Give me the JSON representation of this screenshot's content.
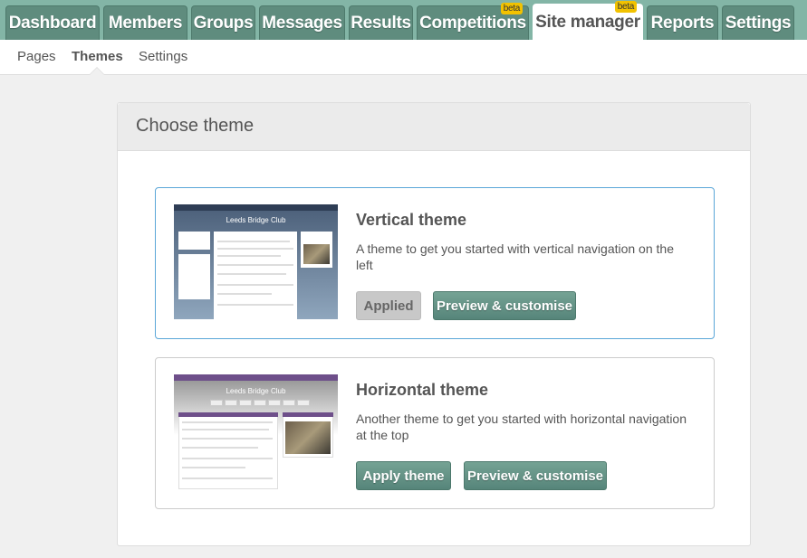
{
  "top_tabs": [
    {
      "label": "Dashboard",
      "badge": ""
    },
    {
      "label": "Members",
      "badge": ""
    },
    {
      "label": "Groups",
      "badge": ""
    },
    {
      "label": "Messages",
      "badge": ""
    },
    {
      "label": "Results",
      "badge": ""
    },
    {
      "label": "Competitions",
      "badge": "beta"
    },
    {
      "label": "Site manager",
      "badge": "beta",
      "active": true
    },
    {
      "label": "Reports",
      "badge": ""
    },
    {
      "label": "Settings",
      "badge": ""
    }
  ],
  "sub_nav": [
    {
      "label": "Pages"
    },
    {
      "label": "Themes",
      "active": true
    },
    {
      "label": "Settings"
    }
  ],
  "panel": {
    "title": "Choose theme"
  },
  "themes": [
    {
      "name": "Vertical theme",
      "description": "A theme to get you started with vertical navigation on the left",
      "primary_button": "Applied",
      "primary_disabled": true,
      "secondary_button": "Preview & customise",
      "preview_site_title": "Leeds Bridge Club"
    },
    {
      "name": "Horizontal theme",
      "description": "Another theme to get you started with horizontal navigation at the top",
      "primary_button": "Apply theme",
      "primary_disabled": false,
      "secondary_button": "Preview & customise",
      "preview_site_title": "Leeds Bridge Club"
    }
  ],
  "colors": {
    "tab_bar": "#83b5a6",
    "tab": "#5f8c7e",
    "button": "#5f8c7e",
    "selected_border": "#5aa6d8",
    "beta_badge": "#f2c200"
  }
}
